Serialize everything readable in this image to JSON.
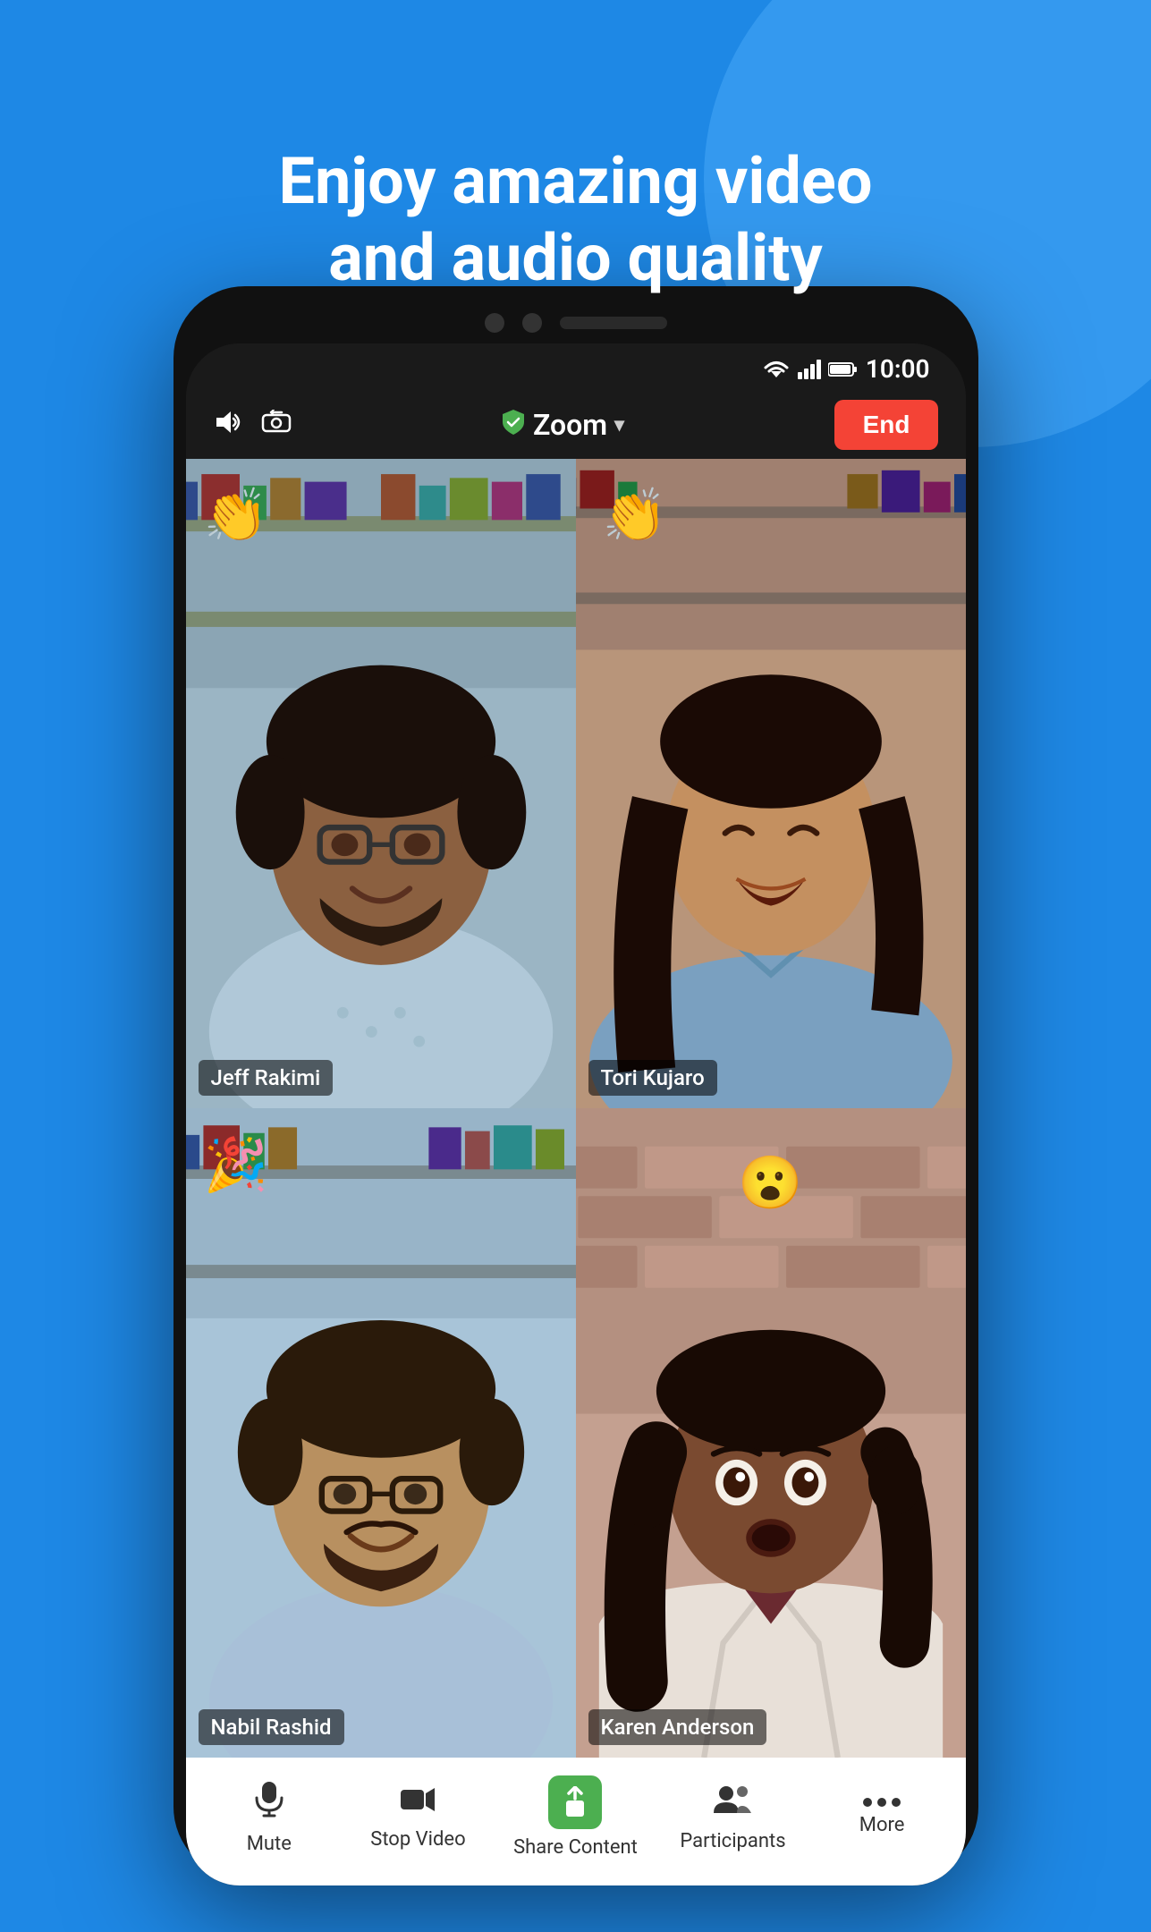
{
  "page": {
    "background_color": "#1E88E5",
    "headline_line1": "Enjoy amazing video",
    "headline_line2": "and audio quality"
  },
  "status_bar": {
    "time": "10:00"
  },
  "call_header": {
    "app_name": "Zoom",
    "end_button": "End"
  },
  "participants": [
    {
      "name": "Jeff Rakimi",
      "emoji": "👏",
      "emoji_position": "top-left",
      "active_speaker": false
    },
    {
      "name": "Tori Kujaro",
      "emoji": "👏",
      "emoji_position": "top-left",
      "active_speaker": true
    },
    {
      "name": "Nabil Rashid",
      "emoji": "🎉",
      "emoji_position": "top-left",
      "active_speaker": false
    },
    {
      "name": "Karen Anderson",
      "emoji": "😮",
      "emoji_position": "top-center",
      "active_speaker": false
    }
  ],
  "toolbar": {
    "mute_label": "Mute",
    "stop_video_label": "Stop Video",
    "share_content_label": "Share Content",
    "participants_label": "Participants",
    "more_label": "More"
  }
}
